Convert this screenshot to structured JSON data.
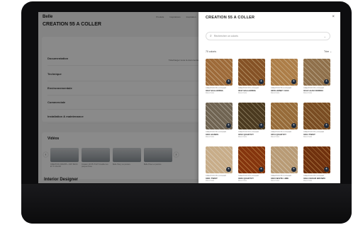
{
  "page": {
    "brand": "Belle",
    "nav_links": [
      "Produits",
      "Inspirations",
      "Inspiration",
      "Services"
    ],
    "title": "CREATION 55 A COLLER",
    "accordion": {
      "link": "Télécharger toute la documentation",
      "sections": [
        "Documentation",
        "Technique",
        "Environnementale",
        "Commerciale",
        "Installation & maintenance"
      ]
    },
    "videos": {
      "title": "Vidéos",
      "captions": [
        "CREATION 30/40/55 + DRY BACK ET 5 COLOR",
        "Création 30 55 70 ET Créaflex les parquet Pose",
        "Belle Harry Lé pesture",
        "Belle Pose Lé pesture"
      ]
    },
    "designer_title": "Interior Designer"
  },
  "drawer": {
    "title": "CREATION 55 A COLLER",
    "close": "×",
    "search_placeholder": "Rechercher un coloris",
    "count": "70 coloris",
    "sort": "Trier",
    "products": [
      {
        "series": "CREATION 55 A COLLER",
        "name": "0347 BALLERINA",
        "sub": "Décor bois",
        "color": "#c9a57a"
      },
      {
        "series": "CREATION 55 A COLLER",
        "name": "0347 BALLERINA",
        "sub": "Décor bois",
        "color": "#b89163"
      },
      {
        "series": "CREATION 55 A COLLER",
        "name": "0356 HONEY OAK",
        "sub": "Décor bois",
        "color": "#d2b388"
      },
      {
        "series": "CREATION 55 A COLLER",
        "name": "0412 LEAD NORDIC",
        "sub": "Décor bois",
        "color": "#bfa98a"
      },
      {
        "series": "CREATION 55 A COLLER",
        "name": "0461 BANKS",
        "sub": "Décor bois",
        "color": "#a9a091"
      },
      {
        "series": "CREATION 55 A COLLER",
        "name": "0452 QUARTZY",
        "sub": "Décor bois",
        "color": "#8a7a5a"
      },
      {
        "series": "CREATION 55 A COLLER",
        "name": "0454 QUARTZY",
        "sub": "Décor bois",
        "color": "#c4a579"
      },
      {
        "series": "CREATION 55 A COLLER",
        "name": "0464 TWIST",
        "sub": "Décor bois",
        "color": "#b08c5e"
      },
      {
        "series": "CREATION 55 A COLLER",
        "name": "0481 TWIST",
        "sub": "Décor bois",
        "color": "#e2d2bb"
      },
      {
        "series": "CREATION 55 A COLLER",
        "name": "0483 QUARTZY",
        "sub": "Décor bois",
        "color": "#b8743c"
      },
      {
        "series": "CREATION 55 A COLLER",
        "name": "0484 WHITE LIME",
        "sub": "Décor bois",
        "color": "#d9c7ad"
      },
      {
        "series": "CREATION 55 A COLLER",
        "name": "0494 CEDAR BROWN",
        "sub": "Décor bois",
        "color": "#a9703c"
      }
    ]
  }
}
